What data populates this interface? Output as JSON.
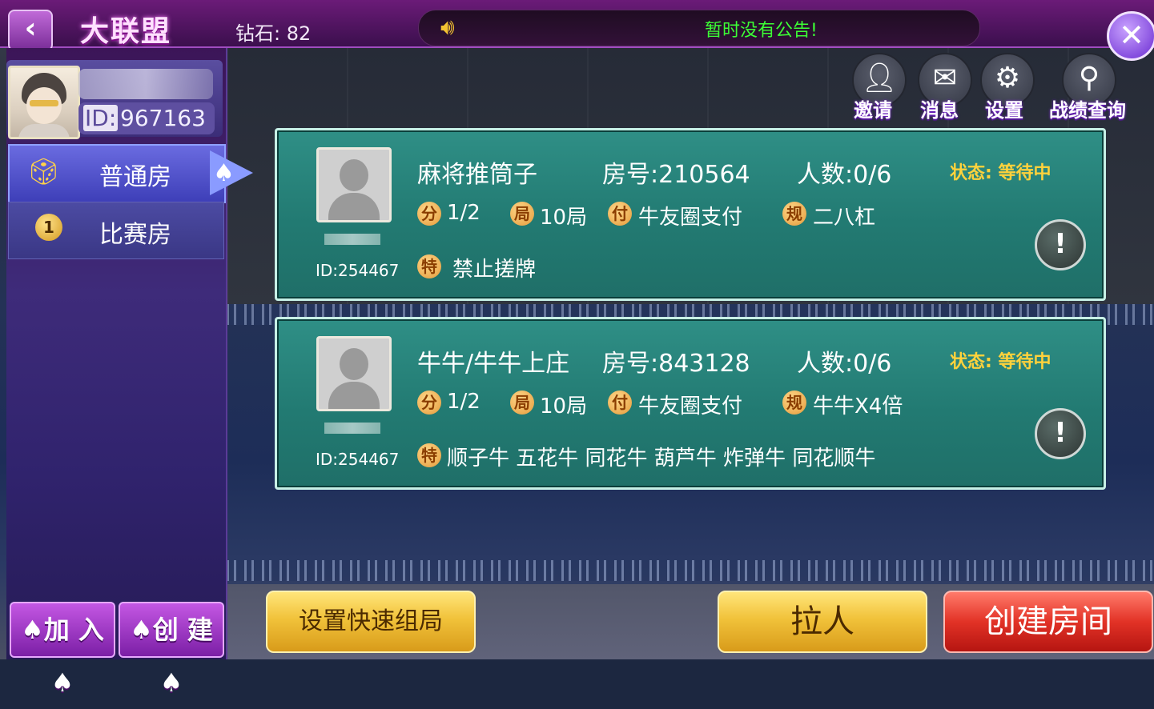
{
  "header": {
    "back_icon": "chevron-left-icon",
    "title": "大联盟",
    "diamond_label": "钻石: 82",
    "notice": "暂时没有公告!",
    "speaker_icon": "speaker-icon",
    "close_icon": "close-icon"
  },
  "toolbar": {
    "invite": "邀请",
    "messages": "消息",
    "settings": "设置",
    "records": "战绩查询"
  },
  "profile": {
    "id_prefix": "ID:",
    "id": "967163"
  },
  "sidebar": {
    "items": [
      {
        "label": "普通房",
        "icon": "dice-icon",
        "active": true
      },
      {
        "label": "比赛房",
        "icon": "medal-icon",
        "active": false
      }
    ],
    "join_label": "♠加 入♠",
    "create_label": "♠创 建♠"
  },
  "rooms": [
    {
      "name": "麻将推筒子",
      "room_no": "房号:210564",
      "count": "人数:0/6",
      "status": "状态: 等待中",
      "owner_id": "ID:254467",
      "tags": [
        {
          "badge": "分",
          "text": "1/2"
        },
        {
          "badge": "局",
          "text": "10局"
        },
        {
          "badge": "付",
          "text": "牛友圈支付"
        },
        {
          "badge": "规",
          "text": "二八杠"
        }
      ],
      "special_badge": "特",
      "special": "禁止搓牌"
    },
    {
      "name": "牛牛/牛牛上庄",
      "room_no": "房号:843128",
      "count": "人数:0/6",
      "status": "状态: 等待中",
      "owner_id": "ID:254467",
      "tags": [
        {
          "badge": "分",
          "text": "1/2"
        },
        {
          "badge": "局",
          "text": "10局"
        },
        {
          "badge": "付",
          "text": "牛友圈支付"
        },
        {
          "badge": "规",
          "text": "牛牛X4倍"
        }
      ],
      "special_badge": "特",
      "special": "顺子牛 五花牛 同花牛 葫芦牛 炸弹牛 同花顺牛"
    }
  ],
  "actions": {
    "quick_setup": "设置快速组局",
    "pull_people": "拉人",
    "create_room": "创建房间"
  },
  "colors": {
    "notice_green": "#3cff35",
    "status_yellow": "#ffd23c",
    "card_teal": "#227a72"
  }
}
